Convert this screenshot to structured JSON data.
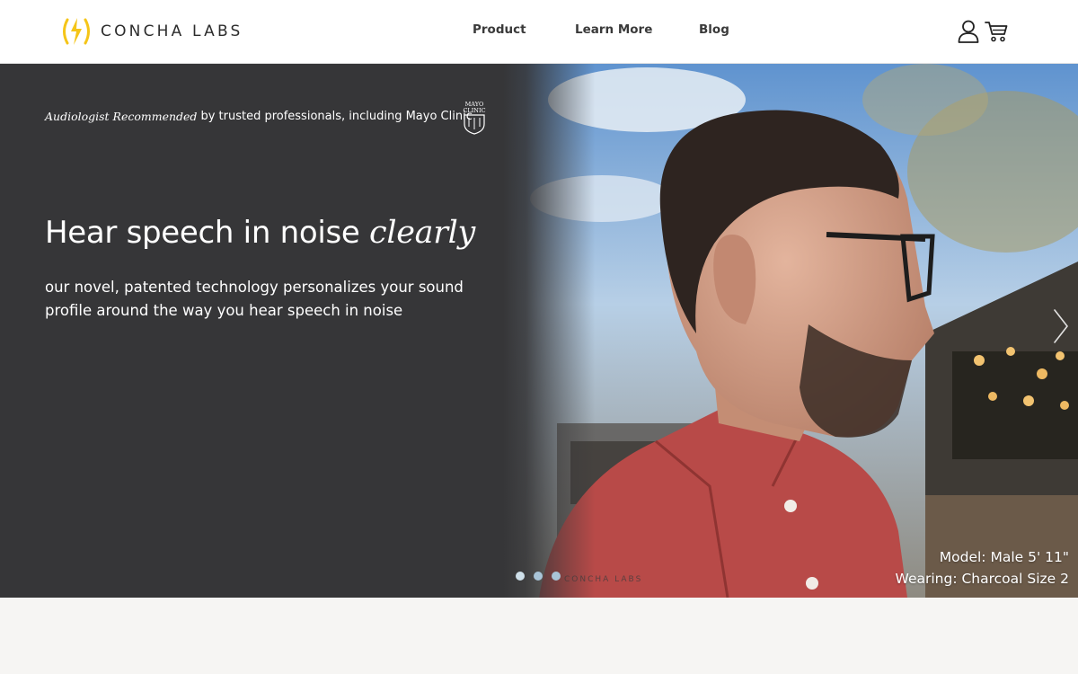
{
  "brand": {
    "name": "CONCHA LABS",
    "accent": "#f5c518"
  },
  "nav": {
    "items": [
      "Product",
      "Learn More",
      "Blog"
    ]
  },
  "header_icons": {
    "account": "user-icon",
    "cart": "cart-icon"
  },
  "hero": {
    "trust_italic": "Audiologist Recommended",
    "trust_text": "by trusted professionals, including Mayo Clinic",
    "mayo_logo_text": "MAYO CLINIC",
    "headline": "Hear speech in noise",
    "headline_emphasis": "clearly",
    "subtext": "our novel, patented technology personalizes your sound profile around the way you hear speech in noise",
    "photo_watermark": "CONCHA LABS",
    "caption_model": "Model: Male 5' 11\"",
    "caption_wearing": "Wearing: Charcoal Size 2",
    "slides": 3,
    "active_slide": 0,
    "background": "#363638"
  }
}
